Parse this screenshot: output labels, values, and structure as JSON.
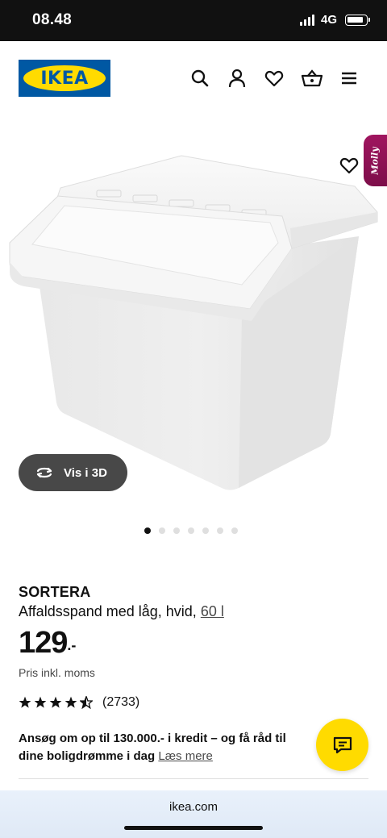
{
  "status_bar": {
    "time": "08.48",
    "network": "4G"
  },
  "header": {
    "logo_text": "IKEA",
    "icons": [
      "search-icon",
      "account-icon",
      "heart-icon",
      "basket-icon",
      "menu-icon"
    ]
  },
  "gallery": {
    "vis_3d_label": "Vis i 3D",
    "molly_label": "Molly",
    "dot_count": 7,
    "active_dot": 0
  },
  "product": {
    "name": "SORTERA",
    "description": "Affaldsspand med låg, hvid,",
    "size": "60 l",
    "price_integer": "129",
    "price_suffix": ".-",
    "vat_note": "Pris inkl. moms",
    "rating_stars": 4.5,
    "rating_count": "(2733)"
  },
  "credit": {
    "text": "Ansøg om op til 130.000.- i kredit – og få råd til dine boligdrømme i dag",
    "link": "Læs mere"
  },
  "browser": {
    "url": "ikea.com"
  },
  "colors": {
    "ikea_blue": "#0058a3",
    "ikea_yellow": "#ffdb00",
    "molly_purple": "#a0155f"
  }
}
